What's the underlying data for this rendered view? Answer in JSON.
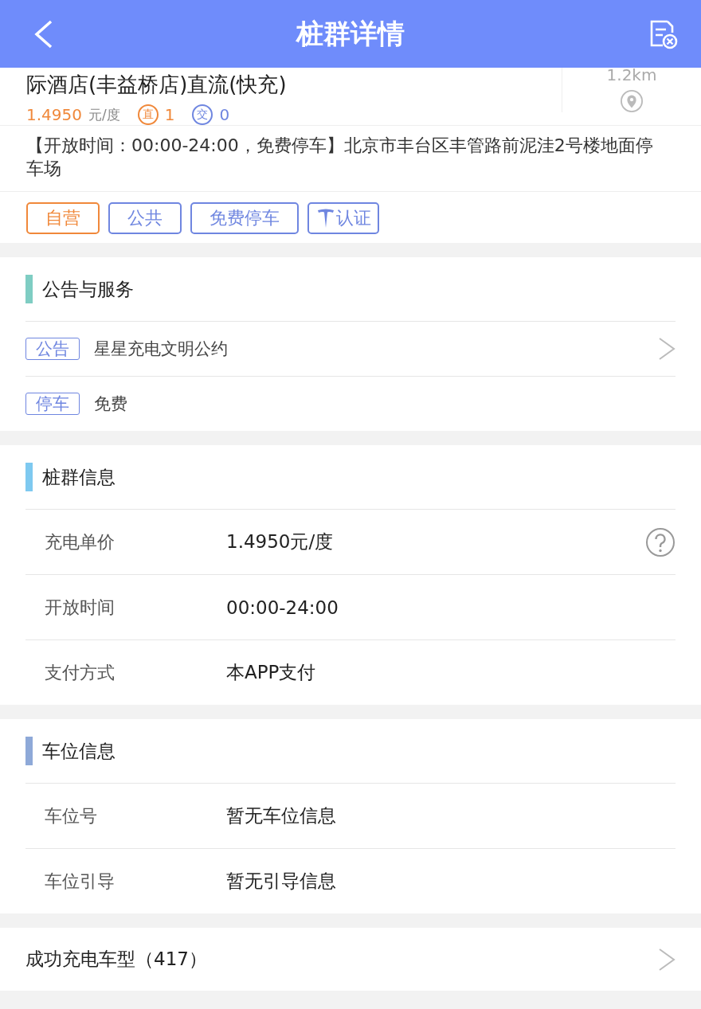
{
  "header": {
    "title": "桩群详情"
  },
  "station": {
    "name": "际酒店(丰益桥店)直流(快充)",
    "distance": "1.2km",
    "price": "1.4950",
    "price_unit": "元/度",
    "dc_icon": "直",
    "dc_count": "1",
    "ac_icon": "交",
    "ac_count": "0",
    "address": "【开放时间：00:00-24:00，免费停车】北京市丰台区丰管路前泥洼2号楼地面停车场",
    "tags": [
      {
        "label": "自营",
        "color": "#f0883a",
        "kind": "text"
      },
      {
        "label": "公共",
        "color": "#6f86e0",
        "kind": "text"
      },
      {
        "label": "免费停车",
        "color": "#6f86e0",
        "kind": "text"
      },
      {
        "label": "认证",
        "color": "#6f86e0",
        "kind": "certified"
      }
    ]
  },
  "sections": [
    {
      "title": "公告与服务",
      "color": "#7fcdc3",
      "kind": "notice",
      "rows": [
        {
          "badge": "公告",
          "text": "星星充电文明公约",
          "link": true
        },
        {
          "badge": "停车",
          "text": "免费",
          "link": false
        }
      ]
    },
    {
      "title": "桩群信息",
      "color": "#7ec9f0",
      "kind": "info",
      "rows": [
        {
          "label": "充电单价",
          "value": "1.4950元/度",
          "help": true
        },
        {
          "label": "开放时间",
          "value": "00:00-24:00",
          "help": false
        },
        {
          "label": "支付方式",
          "value": "本APP支付",
          "help": false
        }
      ]
    },
    {
      "title": "车位信息",
      "color": "#8ea9d8",
      "kind": "info",
      "rows": [
        {
          "label": "车位号",
          "value": "暂无车位信息",
          "help": false
        },
        {
          "label": "车位引导",
          "value": "暂无引导信息",
          "help": false
        }
      ]
    }
  ],
  "models_link": {
    "label": "成功充电车型（417）"
  }
}
